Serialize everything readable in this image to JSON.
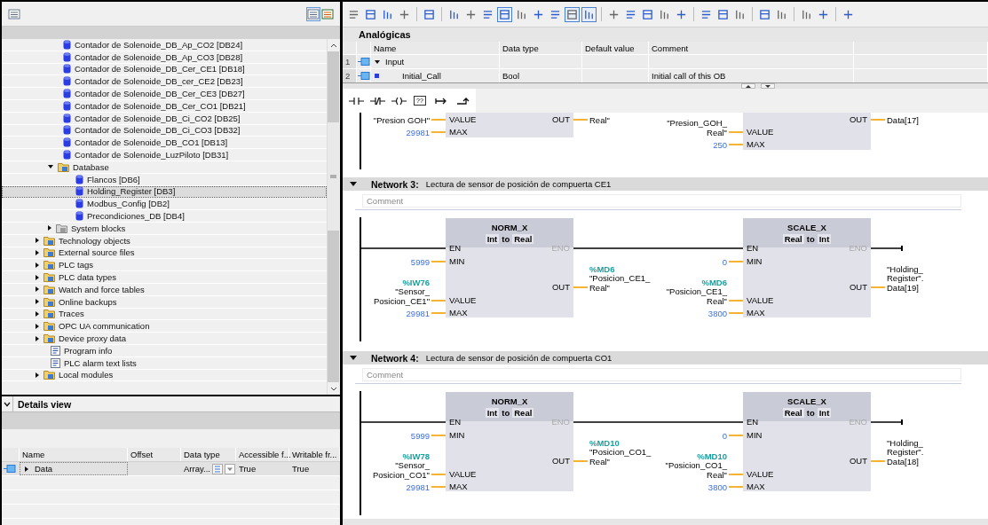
{
  "project_tree": {
    "toolbar": [
      {
        "on": false
      },
      {
        "on": true
      },
      {
        "on": false
      }
    ],
    "items": [
      {
        "children": [
          {
            "label": "Contador de Solenoide_DB_Ap_CO2 [DB24]",
            "kind": "db",
            "selected": false
          },
          {
            "label": "Contador de Solenoide_DB_Ap_CO3 [DB28]",
            "kind": "db",
            "selected": false
          },
          {
            "label": "Contador de Solenoide_DB_Cer_CE1 [DB18]",
            "kind": "db",
            "selected": false
          },
          {
            "label": "Contador de Solenoide_DB_cer_CE2 [DB23]",
            "kind": "db",
            "selected": false
          },
          {
            "label": "Contador de Solenoide_DB_Cer_CE3 [DB27]",
            "kind": "db",
            "selected": false
          },
          {
            "label": "Contador de Solenoide_DB_Cer_CO1 [DB21]",
            "kind": "db",
            "selected": false
          },
          {
            "label": "Contador de Solenoide_DB_Ci_CO2 [DB25]",
            "kind": "db",
            "selected": false
          },
          {
            "label": "Contador de Solenoide_DB_Ci_CO3 [DB32]",
            "kind": "db",
            "selected": false
          },
          {
            "label": "Contador de Solenoide_DB_CO1 [DB13]",
            "kind": "db",
            "selected": false
          },
          {
            "label": "Contador de Solenoide_LuzPiloto [DB31]",
            "kind": "db",
            "selected": false
          },
          {
            "label": "Database",
            "kind": "folder",
            "expanded": true,
            "selected": false,
            "children": [
              {
                "label": "Flancos [DB6]",
                "kind": "db",
                "selected": false
              },
              {
                "label": "Holding_Register [DB3]",
                "kind": "db",
                "selected": true
              },
              {
                "label": "Modbus_Config [DB2]",
                "kind": "db",
                "selected": false
              },
              {
                "label": "Precondiciones_DB [DB4]",
                "kind": "db",
                "selected": false
              }
            ]
          },
          {
            "label": "System blocks",
            "kind": "system",
            "expanded": false,
            "selected": false
          }
        ]
      },
      {
        "label": "Technology objects",
        "kind": "folder",
        "expanded": false,
        "selected": false
      },
      {
        "label": "External source files",
        "kind": "folder",
        "expanded": false,
        "selected": false
      },
      {
        "label": "PLC tags",
        "kind": "folder",
        "expanded": false,
        "selected": false
      },
      {
        "label": "PLC data types",
        "kind": "folder",
        "expanded": false,
        "selected": false
      },
      {
        "label": "Watch and force tables",
        "kind": "folder",
        "expanded": false,
        "selected": false
      },
      {
        "label": "Online backups",
        "kind": "folder",
        "expanded": false,
        "selected": false
      },
      {
        "label": "Traces",
        "kind": "folder",
        "expanded": false,
        "selected": false
      },
      {
        "label": "OPC UA communication",
        "kind": "folder",
        "expanded": false,
        "selected": false
      },
      {
        "label": "Device proxy data",
        "kind": "folder",
        "expanded": false,
        "selected": false
      },
      {
        "label": "Program info",
        "kind": "document",
        "selected": false
      },
      {
        "label": "PLC alarm text lists",
        "kind": "document",
        "selected": false
      },
      {
        "label": "Local modules",
        "kind": "folder",
        "expanded": false,
        "selected": false
      }
    ]
  },
  "details_view": {
    "title": "Details view",
    "expanded": true,
    "columns": [
      "Name",
      "Offset",
      "Data type",
      "Accessible f...",
      "Writable fr..."
    ],
    "rows": [
      {
        "name": "Data",
        "expanded": false,
        "data_type": "Array...",
        "accessible": "True",
        "writable": "True"
      }
    ]
  },
  "editor": {
    "toolbar": [
      [
        {
          "on": false
        },
        {
          "on": false
        },
        {
          "on": false
        },
        {
          "on": false
        }
      ],
      [
        {
          "on": false
        }
      ],
      [
        {
          "on": false
        },
        {
          "on": false
        },
        {
          "on": false
        },
        {
          "on": true
        },
        {
          "on": false
        },
        {
          "on": false
        },
        {
          "on": false
        },
        {
          "on": true
        },
        {
          "on": true
        }
      ],
      [
        {
          "on": false
        },
        {
          "on": false
        },
        {
          "on": false
        },
        {
          "on": false
        },
        {
          "on": false
        }
      ],
      [
        {
          "on": false
        },
        {
          "on": false
        },
        {
          "on": false
        }
      ],
      [
        {
          "on": false
        },
        {
          "on": false
        }
      ],
      [
        {
          "on": false
        },
        {
          "on": false
        }
      ],
      [
        {
          "on": false
        }
      ]
    ],
    "block_title": "Analógicas",
    "interface": {
      "columns": [
        "Name",
        "Data type",
        "Default value",
        "Comment"
      ],
      "rows": [
        {
          "number": "1",
          "kind": "section",
          "name": "Input",
          "expanded": true
        },
        {
          "number": "2",
          "kind": "parameter",
          "name": "Initial_Call",
          "data_type": "Bool",
          "comment": "Initial call of this OB"
        }
      ]
    },
    "instruction_toolbar": [
      {
        "kind": "no-contact"
      },
      {
        "kind": "nc-contact"
      },
      {
        "kind": "coil"
      },
      {
        "kind": "empty-box",
        "glyph": "??"
      },
      {
        "kind": "open-branch"
      },
      {
        "kind": "close-branch"
      }
    ],
    "networks": [
      {
        "kind": "fragment",
        "blocks": [
          {
            "pins": [
              {
                "kind": "input",
                "name": "VALUE",
                "operand": {
                  "kind": "tag",
                  "tag": "\"Presion GOH\""
                }
              },
              {
                "kind": "input",
                "name": "MAX",
                "operand": {
                  "kind": "constant",
                  "value": "29981"
                }
              },
              {
                "kind": "output",
                "name": "OUT",
                "operand": {
                  "kind": "tag",
                  "tag": "Real\""
                }
              }
            ]
          },
          {
            "pins": [
              {
                "kind": "input",
                "name": "VALUE",
                "operand": {
                  "kind": "tag",
                  "tag": "\"Presion_GOH_\nReal\""
                }
              },
              {
                "kind": "input",
                "name": "MAX",
                "operand": {
                  "kind": "constant",
                  "value": "250"
                }
              },
              {
                "kind": "output",
                "name": "OUT",
                "operand": {
                  "kind": "tag",
                  "tag": "Data[17]"
                }
              }
            ]
          }
        ]
      },
      {
        "kind": "full",
        "number": "Network 3:",
        "title": "Lectura de sensor de posición de compuerta CE1",
        "expanded": true,
        "comment_placeholder": "Comment",
        "blocks": [
          {
            "name": "NORM_X",
            "from_type": "Int",
            "conversion_word": "to",
            "to_type": "Real",
            "pins": [
              {
                "kind": "enable-in",
                "name": "EN"
              },
              {
                "kind": "enable-out",
                "name": "ENO"
              },
              {
                "kind": "input",
                "name": "MIN",
                "operand": {
                  "kind": "constant",
                  "value": "5999"
                }
              },
              {
                "kind": "input",
                "name": "VALUE",
                "operand": {
                  "kind": "tag",
                  "address": "%IW76",
                  "tag": "\"Sensor_\nPosicion_CE1\""
                }
              },
              {
                "kind": "input",
                "name": "MAX",
                "operand": {
                  "kind": "constant",
                  "value": "29981"
                }
              },
              {
                "kind": "output",
                "name": "OUT",
                "operand": {
                  "kind": "tag",
                  "address": "%MD6",
                  "tag": "\"Posicion_CE1_\nReal\""
                }
              }
            ]
          },
          {
            "name": "SCALE_X",
            "from_type": "Real",
            "conversion_word": "to",
            "to_type": "Int",
            "pins": [
              {
                "kind": "enable-in",
                "name": "EN"
              },
              {
                "kind": "enable-out",
                "name": "ENO"
              },
              {
                "kind": "input",
                "name": "MIN",
                "operand": {
                  "kind": "constant",
                  "value": "0"
                }
              },
              {
                "kind": "input",
                "name": "VALUE",
                "operand": {
                  "kind": "tag",
                  "address": "%MD6",
                  "tag": "\"Posicion_CE1_\nReal\""
                }
              },
              {
                "kind": "input",
                "name": "MAX",
                "operand": {
                  "kind": "constant",
                  "value": "3800"
                }
              },
              {
                "kind": "output",
                "name": "OUT",
                "operand": {
                  "kind": "tag",
                  "tag": "\"Holding_\nRegister\".\nData[19]"
                }
              }
            ]
          }
        ]
      },
      {
        "kind": "full",
        "number": "Network 4:",
        "title": "Lectura de sensor de posición de compuerta CO1",
        "expanded": true,
        "comment_placeholder": "Comment",
        "blocks": [
          {
            "name": "NORM_X",
            "from_type": "Int",
            "conversion_word": "to",
            "to_type": "Real",
            "pins": [
              {
                "kind": "enable-in",
                "name": "EN"
              },
              {
                "kind": "enable-out",
                "name": "ENO"
              },
              {
                "kind": "input",
                "name": "MIN",
                "operand": {
                  "kind": "constant",
                  "value": "5999"
                }
              },
              {
                "kind": "input",
                "name": "VALUE",
                "operand": {
                  "kind": "tag",
                  "address": "%IW78",
                  "tag": "\"Sensor_\nPosicion_CO1\""
                }
              },
              {
                "kind": "input",
                "name": "MAX",
                "operand": {
                  "kind": "constant",
                  "value": "29981"
                }
              },
              {
                "kind": "output",
                "name": "OUT",
                "operand": {
                  "kind": "tag",
                  "address": "%MD10",
                  "tag": "\"Posicion_CO1_\nReal\""
                }
              }
            ]
          },
          {
            "name": "SCALE_X",
            "from_type": "Real",
            "conversion_word": "to",
            "to_type": "Int",
            "pins": [
              {
                "kind": "enable-in",
                "name": "EN"
              },
              {
                "kind": "enable-out",
                "name": "ENO"
              },
              {
                "kind": "input",
                "name": "MIN",
                "operand": {
                  "kind": "constant",
                  "value": "0"
                }
              },
              {
                "kind": "input",
                "name": "VALUE",
                "operand": {
                  "kind": "tag",
                  "address": "%MD10",
                  "tag": "\"Posicion_CO1_\nReal\""
                }
              },
              {
                "kind": "input",
                "name": "MAX",
                "operand": {
                  "kind": "constant",
                  "value": "3800"
                }
              },
              {
                "kind": "output",
                "name": "OUT",
                "operand": {
                  "kind": "tag",
                  "tag": "\"Holding_\nRegister\".\nData[18]"
                }
              }
            ]
          }
        ]
      }
    ]
  }
}
